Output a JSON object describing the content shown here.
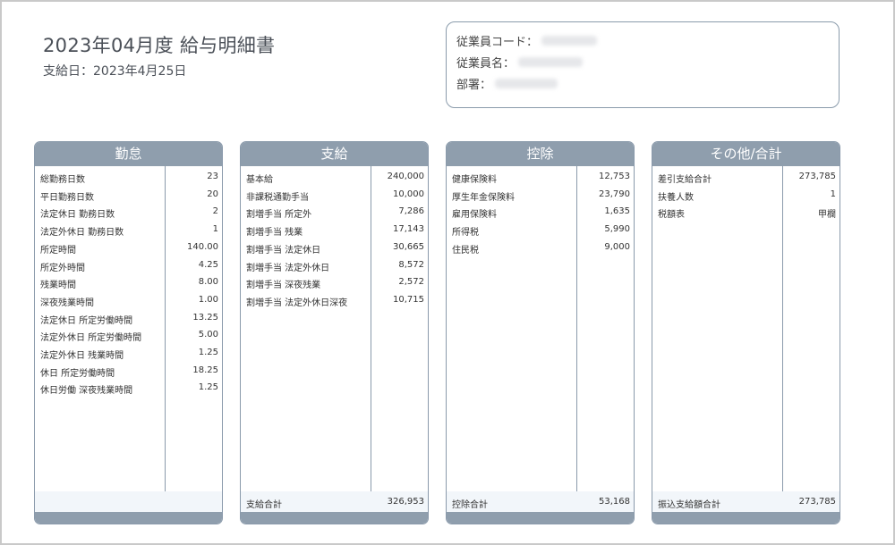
{
  "header": {
    "title": "2023年04月度 給与明細書",
    "pay_date": "支給日：2023年4月25日"
  },
  "employee": {
    "code_label": "従業員コード：",
    "name_label": "従業員名：",
    "dept_label": "部署："
  },
  "panels": {
    "attendance": {
      "title": "勤怠",
      "rows": [
        {
          "label": "総勤務日数",
          "value": "23"
        },
        {
          "label": "平日勤務日数",
          "value": "20"
        },
        {
          "label": "法定休日 勤務日数",
          "value": "2"
        },
        {
          "label": "法定外休日 勤務日数",
          "value": "1"
        },
        {
          "label": "所定時間",
          "value": "140.00"
        },
        {
          "label": "所定外時間",
          "value": "4.25"
        },
        {
          "label": "残業時間",
          "value": "8.00"
        },
        {
          "label": "深夜残業時間",
          "value": "1.00"
        },
        {
          "label": "法定休日 所定労働時間",
          "value": "13.25"
        },
        {
          "label": "法定外休日 所定労働時間",
          "value": "5.00"
        },
        {
          "label": "法定外休日 残業時間",
          "value": "1.25"
        },
        {
          "label": "休日 所定労働時間",
          "value": "18.25"
        },
        {
          "label": "休日労働 深夜残業時間",
          "value": "1.25"
        }
      ],
      "total_label": "",
      "total_value": ""
    },
    "payments": {
      "title": "支給",
      "rows": [
        {
          "label": "基本給",
          "value": "240,000"
        },
        {
          "label": "非課税通勤手当",
          "value": "10,000"
        },
        {
          "label": "割増手当 所定外",
          "value": "7,286"
        },
        {
          "label": "割増手当 残業",
          "value": "17,143"
        },
        {
          "label": "割増手当 法定休日",
          "value": "30,665"
        },
        {
          "label": "割増手当 法定外休日",
          "value": "8,572"
        },
        {
          "label": "割増手当 深夜残業",
          "value": "2,572"
        },
        {
          "label": "割増手当 法定外休日深夜",
          "value": "10,715"
        }
      ],
      "total_label": "支給合計",
      "total_value": "326,953"
    },
    "deductions": {
      "title": "控除",
      "rows": [
        {
          "label": "健康保険料",
          "value": "12,753"
        },
        {
          "label": "厚生年金保険料",
          "value": "23,790"
        },
        {
          "label": "雇用保険料",
          "value": "1,635"
        },
        {
          "label": "所得税",
          "value": "5,990"
        },
        {
          "label": "住民税",
          "value": "9,000"
        }
      ],
      "total_label": "控除合計",
      "total_value": "53,168"
    },
    "other": {
      "title": "その他/合計",
      "rows": [
        {
          "label": "差引支給合計",
          "value": "273,785"
        },
        {
          "label": "扶養人数",
          "value": "1"
        },
        {
          "label": "税額表",
          "value": "甲欄"
        }
      ],
      "total_label": "振込支給額合計",
      "total_value": "273,785"
    }
  },
  "colors": {
    "header_bg": "#8f9ead",
    "border": "#8a9aab",
    "total_bg": "#f2f6fa"
  }
}
